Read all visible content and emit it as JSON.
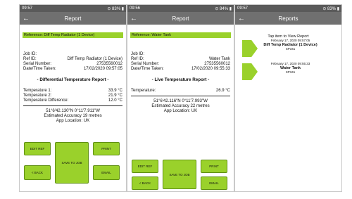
{
  "phone1": {
    "status": {
      "time": "09:57",
      "right": "⊙ 83% ▮"
    },
    "title": "Report",
    "reference": "Reference: Diff Temp Radiator (1 Device)",
    "fields": [
      {
        "label": "Job ID:",
        "value": ""
      },
      {
        "label": "Ref ID:",
        "value": "Diff Temp Radiator (1 Device)"
      },
      {
        "label": "Serial Number:",
        "value": "27535560012"
      },
      {
        "label": "Date/Time Taken:",
        "value": "17/02/2020 09:57:05"
      }
    ],
    "heading": "- Differential Temperature Report -",
    "temps": [
      {
        "label": "Temperature 1:",
        "value": "33.9 °C"
      },
      {
        "label": "Temperature 2:",
        "value": "21.9 °C"
      },
      {
        "label": "Temperature Difference:",
        "value": "12.0 °C"
      }
    ],
    "coords": "51°6'42.130\"N 0°11'7.911\"W",
    "accuracy": "Estimated Accuracy 19 metres",
    "location": "App Location: UK",
    "buttons": {
      "edit_ref": "EDIT REF",
      "save_to_job": "SAVE TO JOB",
      "print": "PRINT",
      "back": "< BACK",
      "email": "EMAIL"
    }
  },
  "phone2": {
    "status": {
      "time": "09:56",
      "right": "⊙ 84% ▮"
    },
    "title": "Report",
    "reference": "Reference: Water Tank",
    "fields": [
      {
        "label": "Job ID:",
        "value": ""
      },
      {
        "label": "Ref ID:",
        "value": "Water Tank"
      },
      {
        "label": "Serial Number:",
        "value": "27535560012"
      },
      {
        "label": "Date/Time Taken:",
        "value": "17/02/2020 09:55:33"
      }
    ],
    "heading": "- Live Temperature Report -",
    "temps": [
      {
        "label": "Temperature:",
        "value": "26.9 °C"
      }
    ],
    "coords": "51°6'42.116\"N 0°11'7.993\"W",
    "accuracy": "Estimated Accuracy 22 metres",
    "location": "App Location: UK",
    "buttons": {
      "edit_ref": "EDIT REF",
      "save_to_job": "SAVE TO JOB",
      "print": "PRINT",
      "back": "< BACK",
      "email": "EMAIL"
    }
  },
  "phone3": {
    "status": {
      "time": "09:57",
      "right": "⊙ 83% ▮"
    },
    "title": "Reports",
    "hint": "Tap item to View Report",
    "items": [
      {
        "date": "February 17, 2020 09:57:05",
        "name": "Diff Temp Radiator (1 Device)",
        "code": "SP341"
      },
      {
        "date": "February 17, 2020 09:55:33",
        "name": "Water Tank",
        "code": "SP341"
      }
    ]
  },
  "icons": {
    "back": "arrow-left-icon",
    "list_item": "green-arrow-icon"
  },
  "colors": {
    "accent": "#9ad12b",
    "appbar": "#707070",
    "statusbar": "#5a5a5a"
  }
}
